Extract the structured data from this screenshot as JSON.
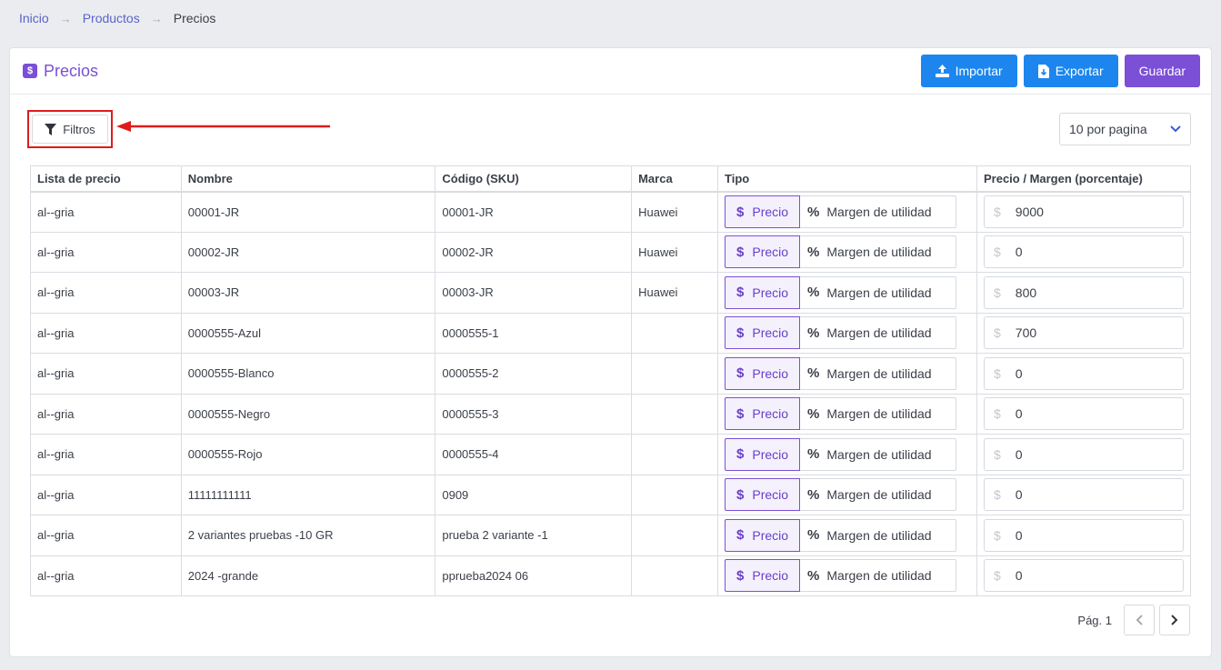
{
  "breadcrumb": [
    "Inicio",
    "Productos",
    "Precios"
  ],
  "page": {
    "title": "Precios",
    "title_icon": "dollar-square-icon"
  },
  "actions": {
    "import_label": "Importar",
    "export_label": "Exportar",
    "save_label": "Guardar"
  },
  "filters": {
    "label": "Filtros"
  },
  "per_page": {
    "label": "10 por pagina"
  },
  "table": {
    "headers": [
      "Lista de precio",
      "Nombre",
      "Código (SKU)",
      "Marca",
      "Tipo",
      "Precio / Margen (porcentaje)"
    ],
    "toggle": {
      "price_label": "Precio",
      "margin_label": "Margen de utilidad"
    },
    "currency_symbol": "$",
    "rows": [
      {
        "list": "al--gria",
        "name": "00001-JR",
        "sku": "00001-JR",
        "brand": "Huawei",
        "value": "9000"
      },
      {
        "list": "al--gria",
        "name": "00002-JR",
        "sku": "00002-JR",
        "brand": "Huawei",
        "value": "0"
      },
      {
        "list": "al--gria",
        "name": "00003-JR",
        "sku": "00003-JR",
        "brand": "Huawei",
        "value": "800"
      },
      {
        "list": "al--gria",
        "name": "0000555-Azul",
        "sku": "0000555-1",
        "brand": "",
        "value": "700"
      },
      {
        "list": "al--gria",
        "name": "0000555-Blanco",
        "sku": "0000555-2",
        "brand": "",
        "value": "0"
      },
      {
        "list": "al--gria",
        "name": "0000555-Negro",
        "sku": "0000555-3",
        "brand": "",
        "value": "0"
      },
      {
        "list": "al--gria",
        "name": "0000555-Rojo",
        "sku": "0000555-4",
        "brand": "",
        "value": "0"
      },
      {
        "list": "al--gria",
        "name": "11111111111",
        "sku": "0909",
        "brand": "",
        "value": "0"
      },
      {
        "list": "al--gria",
        "name": "2 variantes pruebas -10 GR",
        "sku": "prueba 2 variante -1",
        "brand": "",
        "value": "0"
      },
      {
        "list": "al--gria",
        "name": "2024 -grande",
        "sku": "pprueba2024 06",
        "brand": "",
        "value": "0"
      }
    ]
  },
  "pagination": {
    "label": "Pág. 1"
  },
  "colors": {
    "accent": "#7b4fd6",
    "primary": "#1c86ee",
    "highlight": "#e01b1b"
  }
}
